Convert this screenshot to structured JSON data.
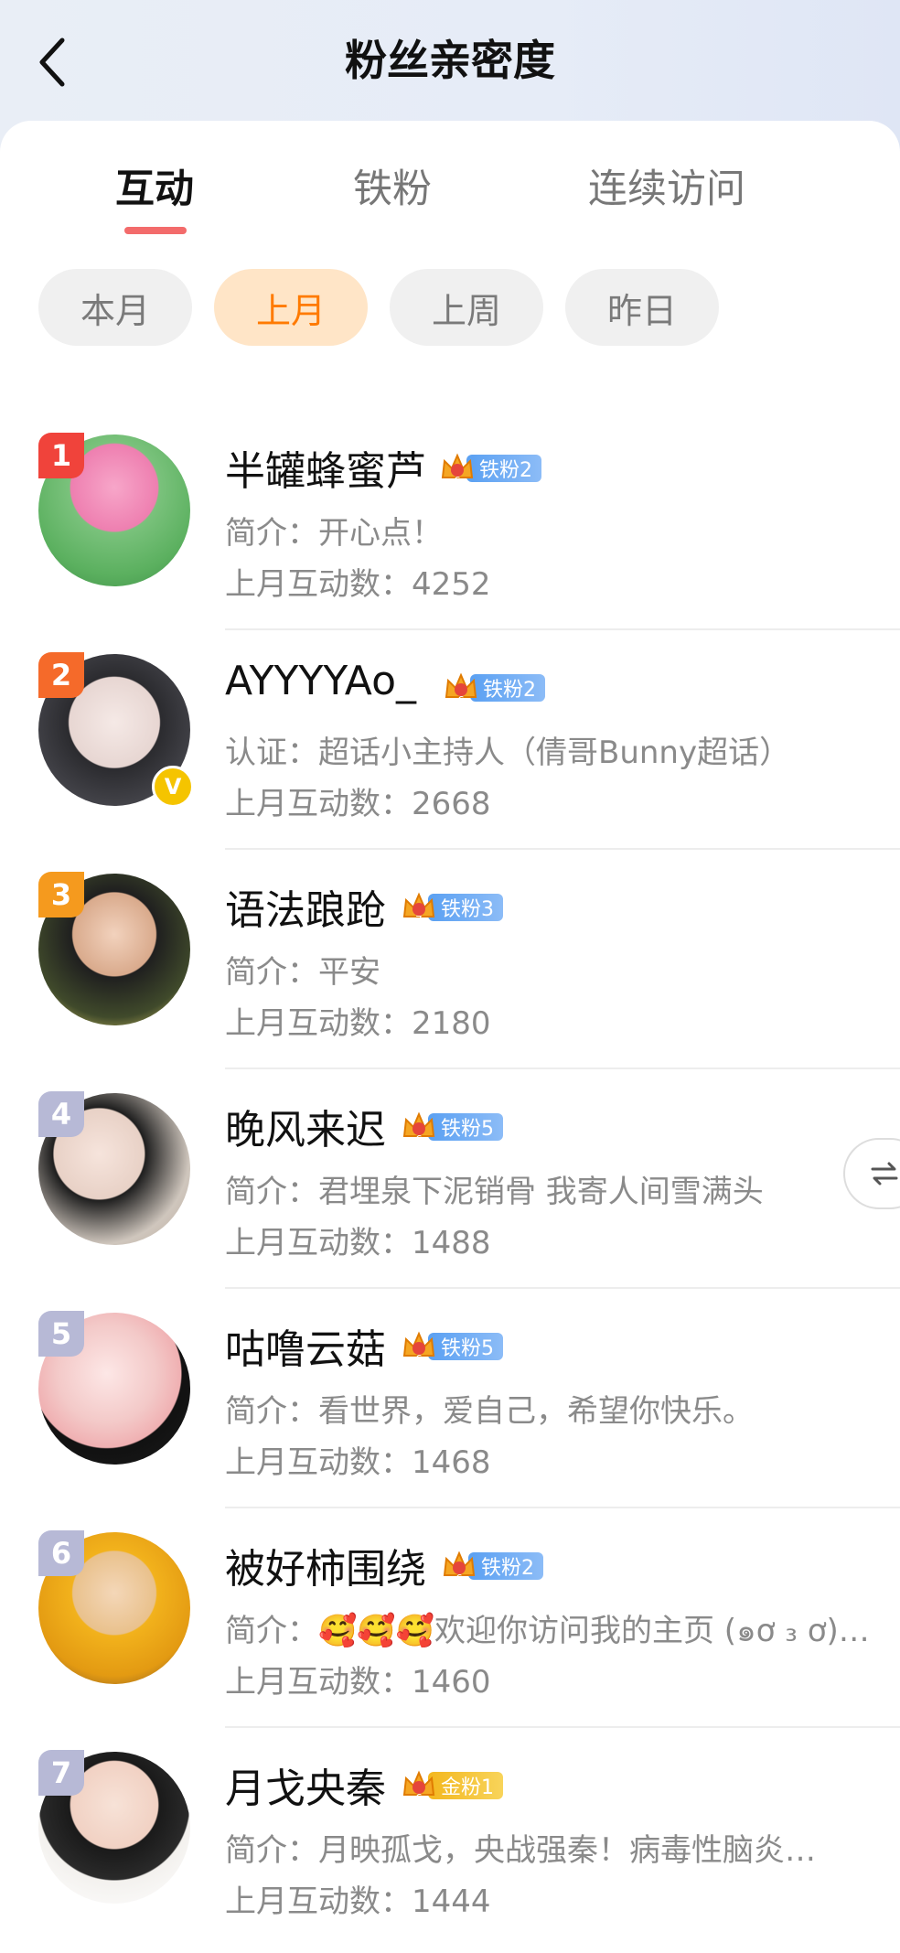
{
  "header": {
    "title": "粉丝亲密度"
  },
  "tabs": [
    {
      "label": "互动",
      "active": true
    },
    {
      "label": "铁粉",
      "active": false
    },
    {
      "label": "连续访问",
      "active": false
    }
  ],
  "filters": [
    {
      "label": "本月",
      "active": false
    },
    {
      "label": "上月",
      "active": true
    },
    {
      "label": "上周",
      "active": false
    },
    {
      "label": "昨日",
      "active": false
    }
  ],
  "fans": [
    {
      "rank": "1",
      "name": "半罐蜂蜜芦",
      "badge": "铁粉2",
      "badge_level": "6",
      "badge_color": "blue",
      "desc": "简介：开心点！",
      "count": "上月互动数：4252",
      "rank_color": "#f0433b"
    },
    {
      "rank": "2",
      "name": "AYYYYAo_",
      "badge": "铁粉2",
      "badge_level": "6",
      "badge_color": "blue",
      "desc": "认证：超话小主持人（倩哥Bunny超话）",
      "count": "上月互动数：2668",
      "rank_color": "#f56a2a",
      "verified": true
    },
    {
      "rank": "3",
      "name": "语法踉跄",
      "badge": "铁粉3",
      "badge_level": "7",
      "badge_color": "blue",
      "desc": "简介：平安",
      "count": "上月互动数：2180",
      "rank_color": "#f59a1e"
    },
    {
      "rank": "4",
      "name": "晚风来迟",
      "badge": "铁粉5",
      "badge_level": "6",
      "badge_color": "blue",
      "desc": "简介：君埋泉下泥销骨 我寄人间雪满头",
      "count": "上月互动数：1488",
      "rank_color": "#b7b9d6"
    },
    {
      "rank": "5",
      "name": "咕噜云菇",
      "badge": "铁粉5",
      "badge_level": "6",
      "badge_color": "blue",
      "desc": "简介：看世界，爱自己，希望你快乐。",
      "count": "上月互动数：1468",
      "rank_color": "#b7b9d6"
    },
    {
      "rank": "6",
      "name": "被好柿围绕",
      "badge": "铁粉2",
      "badge_level": "6",
      "badge_color": "blue",
      "desc": "简介：🥰🥰🥰欢迎你访问我的主页 (๑ơ ₃ ơ)…",
      "count": "上月互动数：1460",
      "rank_color": "#b7b9d6"
    },
    {
      "rank": "7",
      "name": "月戈央秦",
      "badge": "金粉1",
      "badge_level": "6",
      "badge_color": "gold",
      "desc": "简介：月映孤戈，央战强秦！病毒性脑炎…",
      "count": "上月互动数：1444",
      "rank_color": "#b7b9d6"
    }
  ],
  "icons": {
    "back": "chevron-left-icon",
    "float": "swap-icon",
    "crown": "crown-icon",
    "verified": "verified-icon"
  }
}
